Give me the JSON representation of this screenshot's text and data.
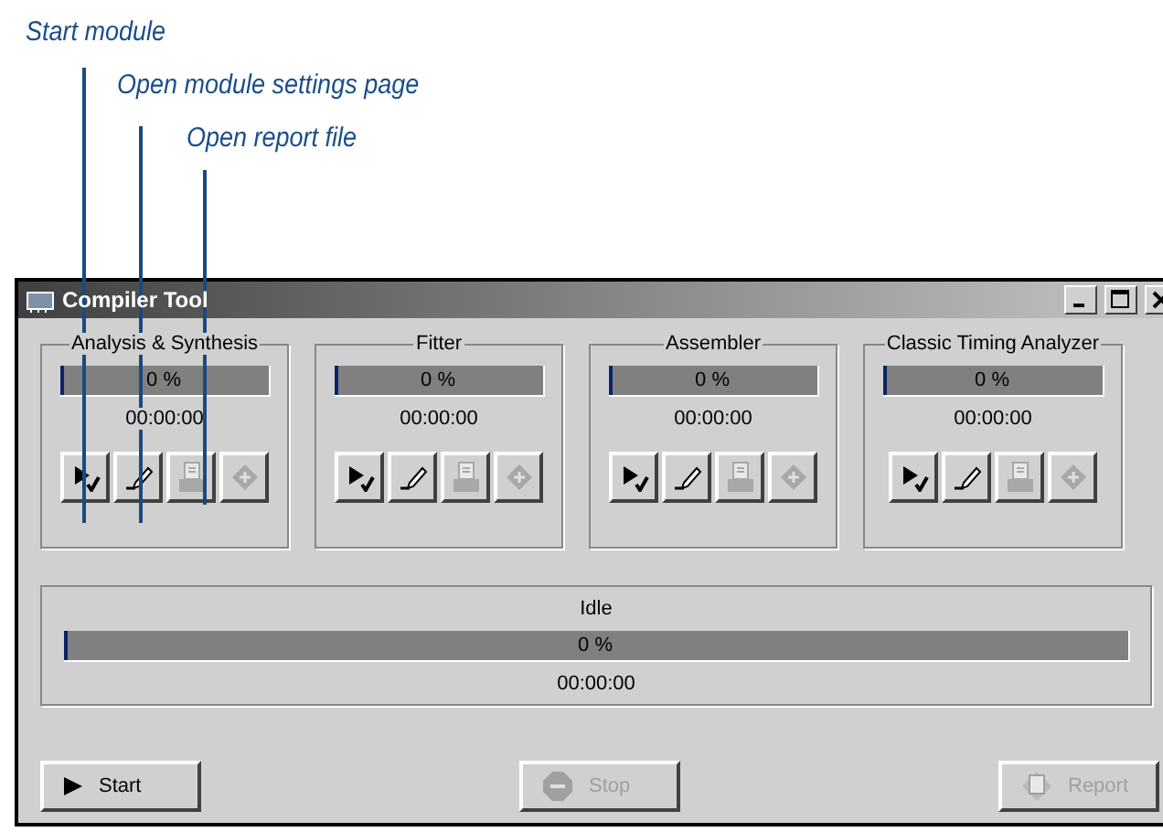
{
  "annotations": [
    {
      "text": "Start module"
    },
    {
      "text": "Open module settings page"
    },
    {
      "text": "Open report file"
    }
  ],
  "window": {
    "title": "Compiler Tool"
  },
  "modules": [
    {
      "name": "Analysis & Synthesis",
      "level": 0,
      "percent": "0 %",
      "time": "00:00:00",
      "buttons": [
        {
          "kind": "start",
          "disabled": false
        },
        {
          "kind": "settings",
          "disabled": false
        },
        {
          "kind": "report",
          "disabled": true
        },
        {
          "kind": "extra",
          "disabled": true
        }
      ]
    },
    {
      "name": "Fitter",
      "level": 0,
      "percent": "0 %",
      "time": "00:00:00",
      "buttons": [
        {
          "kind": "start",
          "disabled": false
        },
        {
          "kind": "settings",
          "disabled": false
        },
        {
          "kind": "report",
          "disabled": true
        },
        {
          "kind": "extra",
          "disabled": true
        }
      ]
    },
    {
      "name": "Assembler",
      "level": 0,
      "percent": "0 %",
      "time": "00:00:00",
      "buttons": [
        {
          "kind": "start",
          "disabled": false
        },
        {
          "kind": "settings",
          "disabled": false
        },
        {
          "kind": "report",
          "disabled": true
        },
        {
          "kind": "extra",
          "disabled": true
        }
      ]
    },
    {
      "name": "Classic Timing Analyzer",
      "level": 0,
      "percent": "0 %",
      "time": "00:00:00",
      "buttons": [
        {
          "kind": "start",
          "disabled": false
        },
        {
          "kind": "settings",
          "disabled": false
        },
        {
          "kind": "report",
          "disabled": true
        },
        {
          "kind": "extra",
          "disabled": true
        }
      ]
    }
  ],
  "overall": {
    "status": "Idle",
    "level": 0,
    "percent": "0 %",
    "time": "00:00:00"
  },
  "actions": [
    {
      "kind": "start",
      "label": "Start",
      "disabled": false
    },
    {
      "kind": "stop",
      "label": "Stop",
      "disabled": true
    },
    {
      "kind": "report",
      "label": "Report",
      "disabled": true
    }
  ]
}
